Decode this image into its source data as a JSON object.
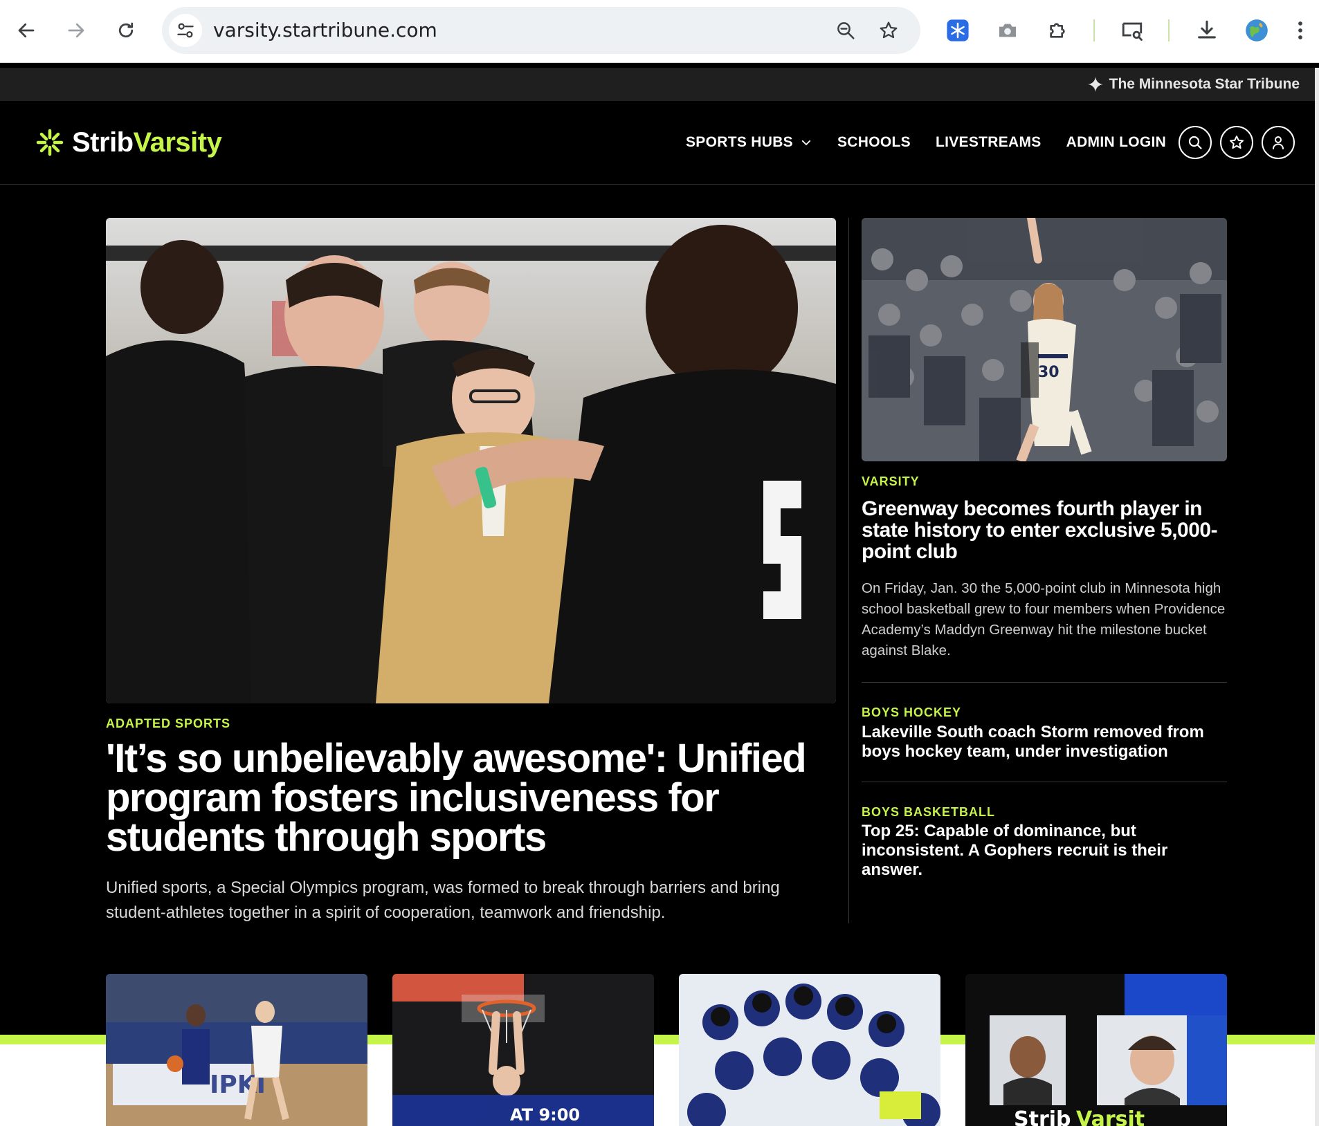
{
  "browser": {
    "url": "varsity.startribune.com"
  },
  "utility_bar": {
    "brand_link": "The Minnesota Star Tribune"
  },
  "header": {
    "logo_strib": "Strib",
    "logo_varsity": "Varsity",
    "nav": [
      "SPORTS HUBS",
      "SCHOOLS",
      "LIVESTREAMS",
      "ADMIN LOGIN"
    ]
  },
  "lead_story": {
    "kicker": "ADAPTED SPORTS",
    "headline": "'It’s so unbelievably awesome': Unified program fosters inclusiveness for students through sports",
    "dek": "Unified sports, a Special Olympics program, was formed to break through barriers and bring student-athletes together in a spirit of cooperation, teamwork and friendship."
  },
  "side_stories": [
    {
      "kicker": "VARSITY",
      "headline": "Greenway becomes fourth player in state history to enter exclusive 5,000-point club",
      "dek": "On Friday, Jan. 30 the 5,000-point club in Minnesota high school basketball grew to four members when Providence Academy’s Maddyn Greenway hit the milestone bucket against Blake."
    },
    {
      "kicker": "BOYS HOCKEY",
      "headline": "Lakeville South coach Storm removed from boys hockey team, under investigation"
    },
    {
      "kicker": "BOYS BASKETBALL",
      "headline": "Top 25: Capable of dominance, but inconsistent. A Gophers recruit is their answer."
    }
  ],
  "colors": {
    "accent": "#c6f54a",
    "background": "#000000",
    "utility_bar": "#1f1f1f"
  }
}
